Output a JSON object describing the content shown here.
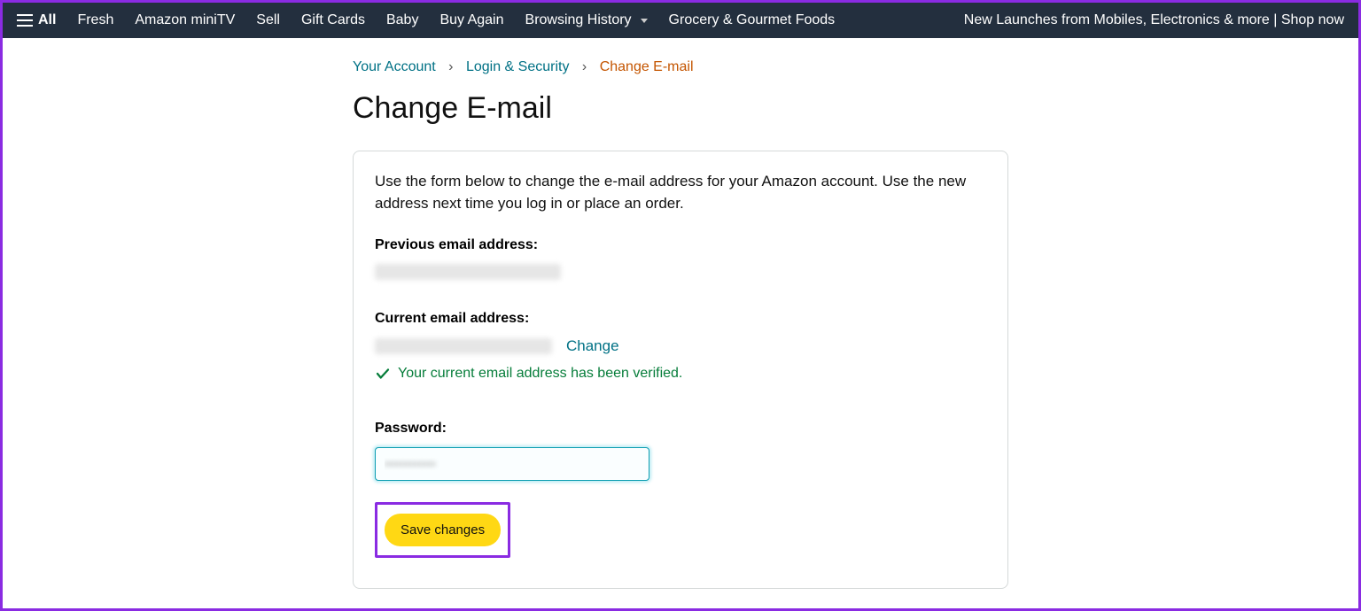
{
  "topnav": {
    "all": "All",
    "items": [
      "Fresh",
      "Amazon miniTV",
      "Sell",
      "Gift Cards",
      "Baby",
      "Buy Again",
      "Browsing History",
      "Grocery & Gourmet Foods"
    ],
    "promo": "New Launches from Mobiles, Electronics & more | Shop now"
  },
  "breadcrumb": {
    "a": "Your Account",
    "b": "Login & Security",
    "c": "Change E-mail"
  },
  "title": "Change E-mail",
  "intro": "Use the form below to change the e-mail address for your Amazon account. Use the new address next time you log in or place an order.",
  "labels": {
    "previous": "Previous email address:",
    "current": "Current email address:",
    "password": "Password:"
  },
  "change": "Change",
  "verified": "Your current email address has been verified.",
  "save": "Save changes"
}
